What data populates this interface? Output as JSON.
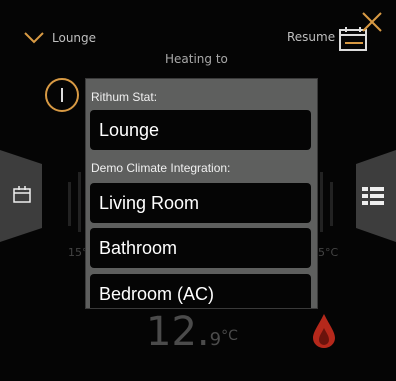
{
  "header": {
    "room_label": "Lounge",
    "heating_label": "Heating to",
    "resume_label": "Resume",
    "icons": [
      "chevron-down-icon",
      "calendar-schedule-icon",
      "close-icon",
      "power-icon"
    ]
  },
  "dial": {
    "min_label": "15°",
    "max_label": "5°C",
    "current_temp_int": "12.",
    "current_temp_dec": "9",
    "current_temp_unit": "°C",
    "mode_icon": "flame-drop-icon",
    "accent_color": "#d89a44",
    "drop_color": "#b5281b"
  },
  "side_tabs": {
    "left_icon": "calendar-icon",
    "right_icon": "grid-list-icon"
  },
  "dropdown": {
    "groups": [
      {
        "label": "Rithum Stat:",
        "items": [
          "Lounge"
        ]
      },
      {
        "label": "Demo Climate Integration:",
        "items": [
          "Living Room",
          "Bathroom",
          "Bedroom (AC)"
        ]
      }
    ]
  }
}
